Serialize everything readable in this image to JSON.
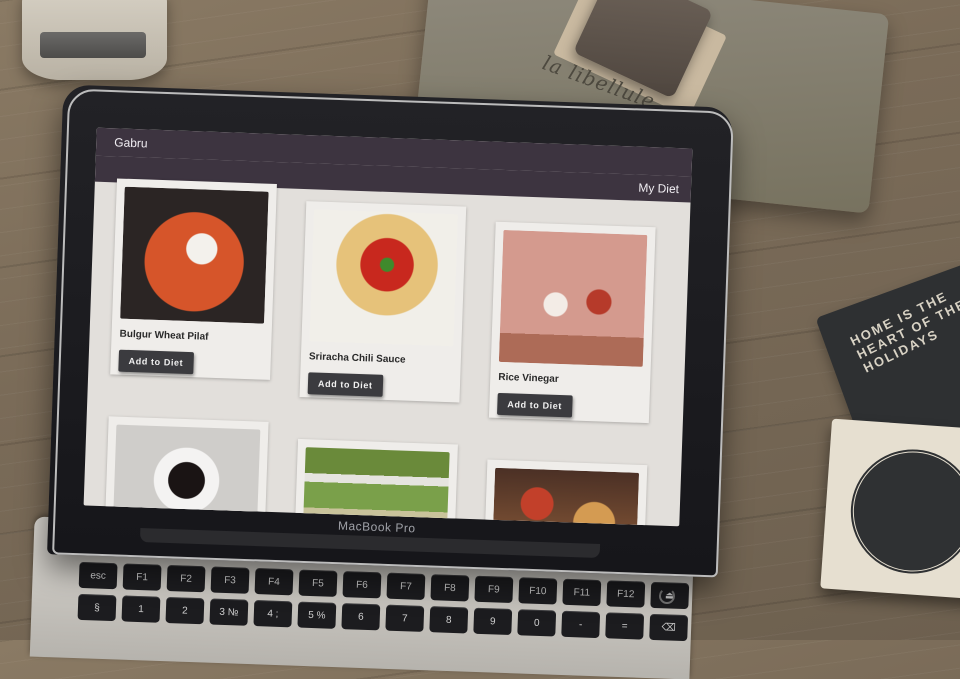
{
  "app": {
    "title": "Gabru",
    "nav_label": "My Diet"
  },
  "foods": [
    {
      "name": "Bulgur Wheat Pilaf",
      "button": "Add to Diet"
    },
    {
      "name": "Sriracha Chili Sauce",
      "button": "Add to Diet"
    },
    {
      "name": "Rice Vinegar",
      "button": "Add to Diet"
    }
  ],
  "laptop": {
    "model_label": "MacBook Pro"
  },
  "keys": {
    "row1": [
      "esc",
      "F1",
      "F2",
      "F3",
      "F4",
      "F5",
      "F6",
      "F7",
      "F8",
      "F9",
      "F10",
      "F11",
      "F12",
      "⏏"
    ],
    "row2": [
      "§",
      "1",
      "2",
      "3 №",
      "4 ;",
      "5 %",
      "6",
      "7",
      "8",
      "9",
      "0",
      "-",
      "=",
      "⌫"
    ]
  },
  "props": {
    "pouch_text": "la libellule",
    "coaster_text": "HOME IS THE HEART OF THE HOLIDAYS"
  }
}
